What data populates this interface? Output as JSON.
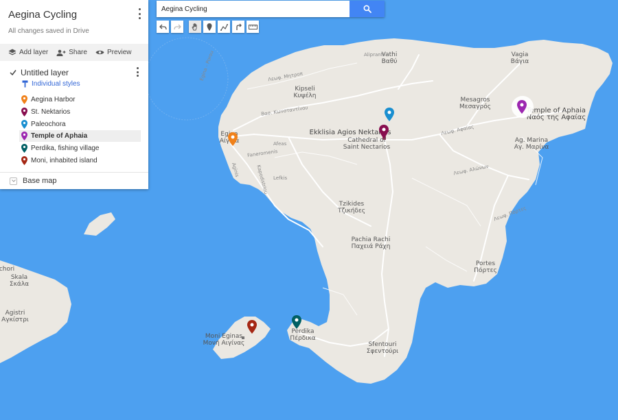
{
  "panel": {
    "title": "Aegina Cycling",
    "saved_status": "All changes saved in Drive",
    "actions": {
      "add_layer": "Add layer",
      "share": "Share",
      "preview": "Preview"
    },
    "layer": {
      "name": "Untitled layer",
      "styles_label": "Individual styles",
      "items": [
        {
          "label": "Aegina Harbor",
          "color": "#f0811a"
        },
        {
          "label": "St. Nektarios",
          "color": "#880e4f"
        },
        {
          "label": "Paleochora",
          "color": "#1a8fd0"
        },
        {
          "label": "Temple of Aphaia",
          "color": "#9c27b0"
        },
        {
          "label": "Perdika, fishing village",
          "color": "#006064"
        },
        {
          "label": "Moni, inhabited island",
          "color": "#a52714"
        }
      ]
    },
    "base_map": "Base map"
  },
  "search": {
    "value": "Aegina Cycling"
  },
  "toolbar": {
    "tools": [
      "undo-icon",
      "redo-icon",
      "hand-icon",
      "marker-icon",
      "draw-line-icon",
      "directions-icon",
      "ruler-icon"
    ]
  },
  "map": {
    "colors": {
      "water": "#4da0f0",
      "land": "#ebe8e2",
      "roads": "#ffffff"
    },
    "place_labels": {
      "vathi": "Vathi\nΒαθύ",
      "vagia": "Vagia\nΒάγια",
      "kipseli": "Kipseli\nΚυψέλη",
      "mesagros": "Mesagros\nΜεσαγρός",
      "temple": "Temple of Aphaia\nΝαός της Αφαίας",
      "egina": "Egina\nΑίγινα",
      "nektarios": "Ekklisia Agios Nektarios",
      "cathedral": "Cathedral of\nSaint Nectarios",
      "agmarina": "Ag. Marina\nΑγ. Μαρίνα",
      "tzikides": "Tzikides\nΤζικήδες",
      "pachia": "Pachia Rachi\nΠαχειά Ράχη",
      "portes": "Portes\nΠόρτες",
      "moni": "Moni Eginas\nΜονή Αιγίνας",
      "perdika": "Perdika\nΠέρδικα",
      "sfentouri": "Sfentouri\nΣφεντούρι",
      "chori": "chori",
      "skala": "Skala\nΣκάλα",
      "agistri": "Agistri\nΑγκίστρι"
    },
    "road_labels": {
      "alipranti": "Alipranti",
      "mitropo": "Λεωφ. Μητροπ",
      "konstantinou": "Βασ. Κωνσταντίνου",
      "afeas": "Afeas",
      "faneromenis": "Faneromenis",
      "lefkis": "Lefkis",
      "kapodistriou": "Kapodistriou",
      "aiginis": "Aginis",
      "afaias": "Λεωφ. Αφαίας",
      "alonion": "Λεωφ. Αλώνων",
      "portes_rd": "Λεωφ. Πόρτες",
      "egina_porou": "Egina - Porou"
    }
  }
}
